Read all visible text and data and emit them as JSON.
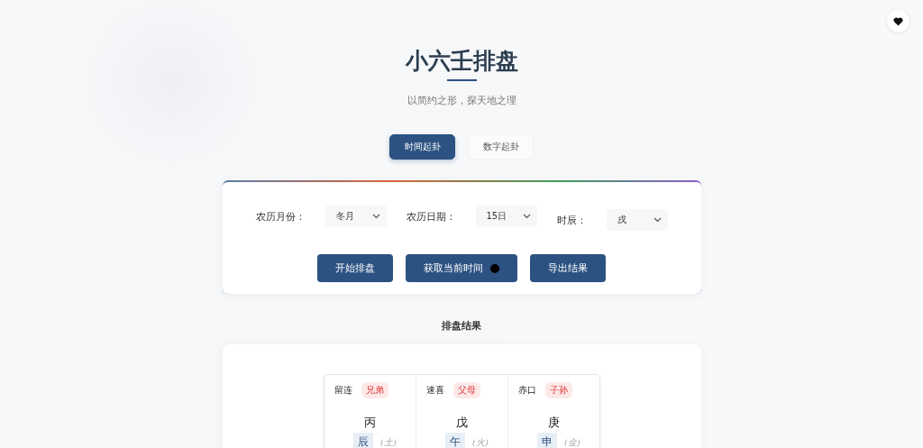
{
  "title": "小六壬排盘",
  "subtitle": "以简约之形，探天地之理",
  "tabs": [
    {
      "label": "时间起卦",
      "selected": true
    },
    {
      "label": "数字起卦",
      "selected": false
    }
  ],
  "fields": [
    {
      "label": "农历月份：",
      "value": "冬月"
    },
    {
      "label": "农历日期：",
      "value": "15日"
    },
    {
      "label": "时辰：",
      "value": "戌"
    }
  ],
  "buttons": [
    {
      "label": "开始排盘",
      "indicator": false
    },
    {
      "label": "获取当前时间",
      "indicator": true
    },
    {
      "label": "导出结果",
      "indicator": false
    }
  ],
  "results_title": "排盘结果",
  "palaces": [
    {
      "name": "留连",
      "relation": "兄弟",
      "stem": "丙",
      "branch": "辰",
      "element": "(土)"
    },
    {
      "name": "速喜",
      "relation": "父母",
      "stem": "戊",
      "branch": "午",
      "element": "(火)"
    },
    {
      "name": "赤口",
      "relation": "子孙",
      "stem": "庚",
      "branch": "申",
      "element": "(金)"
    }
  ]
}
